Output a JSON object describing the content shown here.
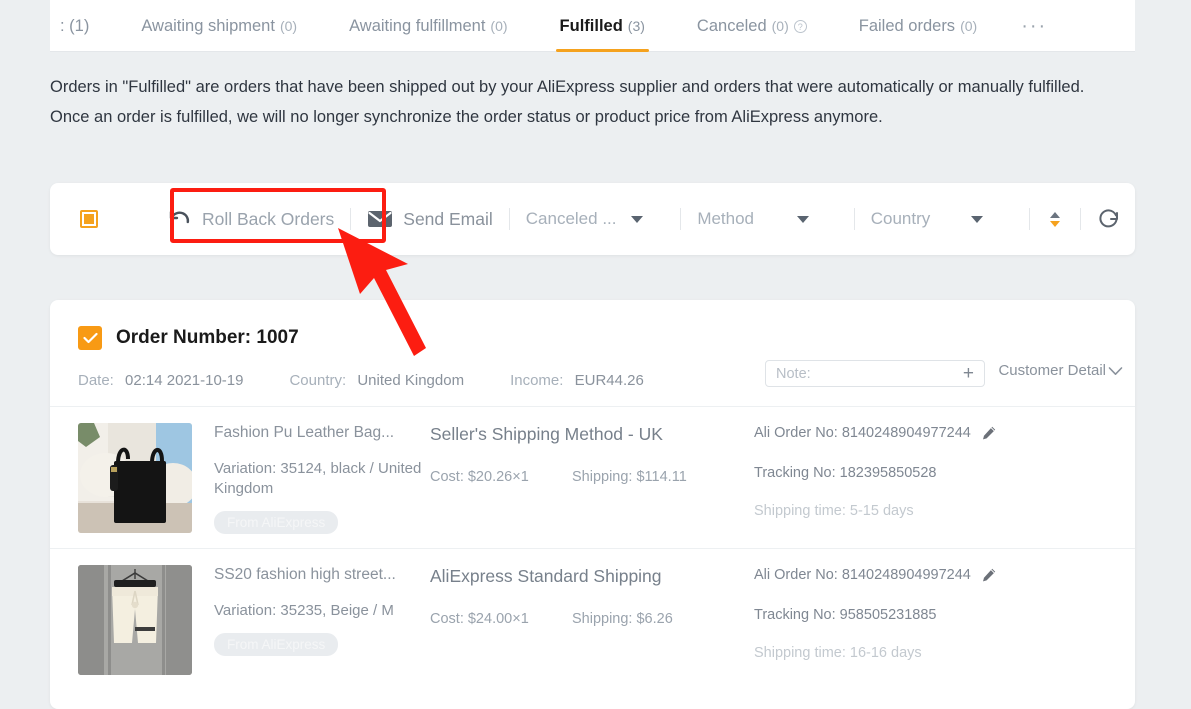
{
  "tabs": [
    {
      "label": ": (1)",
      "count": "",
      "active": false,
      "truncated": true
    },
    {
      "label": "Awaiting shipment",
      "count": "(0)",
      "active": false
    },
    {
      "label": "Awaiting fulfillment",
      "count": "(0)",
      "active": false
    },
    {
      "label": "Fulfilled",
      "count": "(3)",
      "active": true
    },
    {
      "label": "Canceled",
      "count": "(0)",
      "active": false,
      "help": true
    },
    {
      "label": "Failed orders",
      "count": "(0)",
      "active": false
    },
    {
      "label": "···",
      "count": "",
      "active": false,
      "more": true
    }
  ],
  "description": "Orders in \"Fulfilled\" are orders that have been shipped out by your AliExpress supplier and orders that were automatically or manually fulfilled. Once an order is fulfilled, we will no longer synchronize the order status or product price from AliExpress anymore.",
  "toolbar": {
    "select_all_state": "indeterminate",
    "rollback_label": "Roll Back Orders",
    "rollback_icon": "undo-icon",
    "send_email_label": "Send Email",
    "send_email_icon": "mail-icon",
    "filters": [
      {
        "name": "canceled-filter",
        "label": "Canceled ..."
      },
      {
        "name": "method-filter",
        "label": "Method"
      },
      {
        "name": "country-filter",
        "label": "Country"
      }
    ],
    "sort_icon": "sort-arrows-icon",
    "refresh_icon": "refresh-icon"
  },
  "order": {
    "checkbox_state": "checked",
    "title": "Order Number: 1007",
    "meta": [
      {
        "key": "Date:",
        "value": "02:14 2021-10-19"
      },
      {
        "key": "Country:",
        "value": "United Kingdom"
      },
      {
        "key": "Income:",
        "value": "EUR44.26"
      }
    ],
    "note_placeholder": "Note:",
    "note_add_icon": "plus-icon",
    "customer_detail_label": "Customer Detail",
    "customer_detail_icon": "chevron-down-icon",
    "items": [
      {
        "image": "black-leather-tote-bag-on-bed",
        "name": "Fashion Pu Leather Bag...",
        "variation": "Variation: 35124, black / United Kingdom",
        "source_tag": "From AliExpress",
        "shipping_method": "Seller's Shipping Method - UK",
        "cost": "Cost: $20.26×1",
        "shipping": "Shipping: $114.11",
        "ali_order_no": "Ali Order No: 8140248904977244",
        "tracking_no": "Tracking No: 182395850528",
        "shipping_time": "Shipping time: 5-15 days",
        "edit_icon": "pencil-icon"
      },
      {
        "image": "beige-shorts-on-hanger",
        "name": "SS20 fashion high street...",
        "variation": "Variation: 35235, Beige / M",
        "source_tag": "From AliExpress",
        "shipping_method": "AliExpress Standard Shipping",
        "cost": "Cost: $24.00×1",
        "shipping": "Shipping: $6.26",
        "ali_order_no": "Ali Order No: 8140248904997244",
        "tracking_no": "Tracking No: 958505231885",
        "shipping_time": "Shipping time: 16-16 days",
        "edit_icon": "pencil-icon"
      }
    ]
  },
  "annotations": {
    "highlight_color": "#fc1d11",
    "highlight_target": "Roll Back Orders",
    "arrow": "red-arrow-pointing-to-roll-back-orders"
  },
  "colors": {
    "accent": "#f5a21e",
    "page_bg": "#eceff1",
    "card_bg": "#ffffff",
    "text": "#2f3640",
    "muted": "#9aa3ad"
  }
}
